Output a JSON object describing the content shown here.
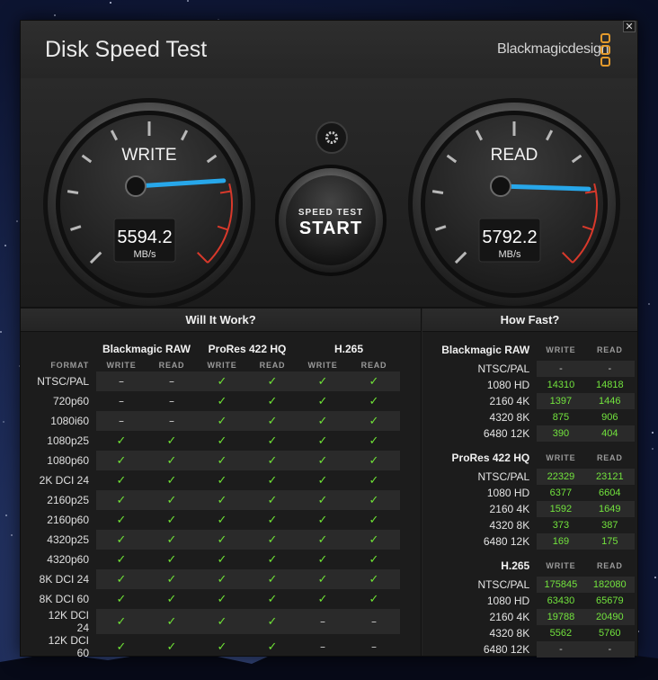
{
  "window": {
    "title": "Disk Speed Test",
    "brand": "Blackmagicdesign",
    "close": "✕"
  },
  "write_gauge": {
    "label": "WRITE",
    "value": "5594.2",
    "unit": "MB/s",
    "level": 0.82
  },
  "read_gauge": {
    "label": "READ",
    "value": "5792.2",
    "unit": "MB/s",
    "level": 0.84
  },
  "start_button": {
    "line1": "SPEED TEST",
    "line2": "START"
  },
  "will_it_work": {
    "title": "Will It Work?",
    "format_label": "FORMAT",
    "groups": [
      "Blackmagic RAW",
      "ProRes 422 HQ",
      "H.265"
    ],
    "write_label": "WRITE",
    "read_label": "READ",
    "rows": [
      {
        "format": "NTSC/PAL",
        "cells": [
          "–",
          "–",
          "✓",
          "✓",
          "✓",
          "✓"
        ]
      },
      {
        "format": "720p60",
        "cells": [
          "–",
          "–",
          "✓",
          "✓",
          "✓",
          "✓"
        ]
      },
      {
        "format": "1080i60",
        "cells": [
          "–",
          "–",
          "✓",
          "✓",
          "✓",
          "✓"
        ]
      },
      {
        "format": "1080p25",
        "cells": [
          "✓",
          "✓",
          "✓",
          "✓",
          "✓",
          "✓"
        ]
      },
      {
        "format": "1080p60",
        "cells": [
          "✓",
          "✓",
          "✓",
          "✓",
          "✓",
          "✓"
        ]
      },
      {
        "format": "2K DCI 24",
        "cells": [
          "✓",
          "✓",
          "✓",
          "✓",
          "✓",
          "✓"
        ]
      },
      {
        "format": "2160p25",
        "cells": [
          "✓",
          "✓",
          "✓",
          "✓",
          "✓",
          "✓"
        ]
      },
      {
        "format": "2160p60",
        "cells": [
          "✓",
          "✓",
          "✓",
          "✓",
          "✓",
          "✓"
        ]
      },
      {
        "format": "4320p25",
        "cells": [
          "✓",
          "✓",
          "✓",
          "✓",
          "✓",
          "✓"
        ]
      },
      {
        "format": "4320p60",
        "cells": [
          "✓",
          "✓",
          "✓",
          "✓",
          "✓",
          "✓"
        ]
      },
      {
        "format": "8K DCI 24",
        "cells": [
          "✓",
          "✓",
          "✓",
          "✓",
          "✓",
          "✓"
        ]
      },
      {
        "format": "8K DCI 60",
        "cells": [
          "✓",
          "✓",
          "✓",
          "✓",
          "✓",
          "✓"
        ]
      },
      {
        "format": "12K DCI 24",
        "cells": [
          "✓",
          "✓",
          "✓",
          "✓",
          "–",
          "–"
        ]
      },
      {
        "format": "12K DCI 60",
        "cells": [
          "✓",
          "✓",
          "✓",
          "✓",
          "–",
          "–"
        ]
      }
    ]
  },
  "how_fast": {
    "title": "How Fast?",
    "write_label": "WRITE",
    "read_label": "READ",
    "groups": [
      {
        "name": "Blackmagic RAW",
        "rows": [
          {
            "format": "NTSC/PAL",
            "write": "-",
            "read": "-"
          },
          {
            "format": "1080 HD",
            "write": "14310",
            "read": "14818"
          },
          {
            "format": "2160 4K",
            "write": "1397",
            "read": "1446"
          },
          {
            "format": "4320 8K",
            "write": "875",
            "read": "906"
          },
          {
            "format": "6480 12K",
            "write": "390",
            "read": "404"
          }
        ]
      },
      {
        "name": "ProRes 422 HQ",
        "rows": [
          {
            "format": "NTSC/PAL",
            "write": "22329",
            "read": "23121"
          },
          {
            "format": "1080 HD",
            "write": "6377",
            "read": "6604"
          },
          {
            "format": "2160 4K",
            "write": "1592",
            "read": "1649"
          },
          {
            "format": "4320 8K",
            "write": "373",
            "read": "387"
          },
          {
            "format": "6480 12K",
            "write": "169",
            "read": "175"
          }
        ]
      },
      {
        "name": "H.265",
        "rows": [
          {
            "format": "NTSC/PAL",
            "write": "175845",
            "read": "182080"
          },
          {
            "format": "1080 HD",
            "write": "63430",
            "read": "65679"
          },
          {
            "format": "2160 4K",
            "write": "19788",
            "read": "20490"
          },
          {
            "format": "4320 8K",
            "write": "5562",
            "read": "5760"
          },
          {
            "format": "6480 12K",
            "write": "-",
            "read": "-"
          }
        ]
      }
    ]
  },
  "colors": {
    "check": "#6fe236",
    "number": "#72e33d",
    "needle": "#27a7ea",
    "redzone": "#d8392b",
    "brand": "#e49a2c"
  }
}
